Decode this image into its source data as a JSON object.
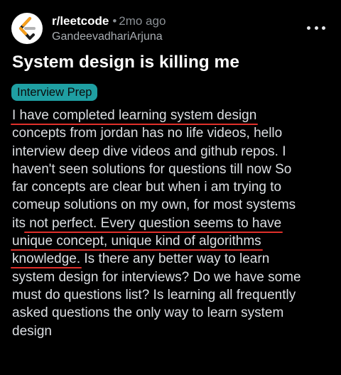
{
  "post": {
    "subreddit": "r/leetcode",
    "separator": "•",
    "time": "2mo ago",
    "author": "GandeevadhariArjuna",
    "title": "System design is killing me",
    "flair": "Interview Prep",
    "body_lines": [
      [
        "I have completed learning system design",
        ""
      ],
      [
        "concepts from jordan has no life videos, hello",
        ""
      ],
      [
        "interview deep dive videos and github repos. I",
        ""
      ],
      [
        "haven't seen solutions for questions till now So",
        ""
      ],
      [
        "far concepts are clear but when i am trying to",
        ""
      ],
      [
        "comeup solutions on my own, for most systems",
        ""
      ],
      [
        "its",
        " not perfect. Every question seems to have"
      ],
      [
        "unique concept, unique kind of algorithms",
        ""
      ],
      [
        "knowledge.",
        " Is there any better way to learn"
      ],
      [
        "system design for interviews? Do we have some",
        ""
      ],
      [
        "must do questions list? Is learning all frequently",
        ""
      ],
      [
        "asked questions the only way to learn system",
        ""
      ],
      [
        "design",
        ""
      ]
    ]
  },
  "icons": {
    "avatar": "leetcode-logo",
    "more": "more-horizontal-icon"
  },
  "colors": {
    "background": "#000000",
    "flair_bg": "#1f9fa2",
    "underline": "#e0302b",
    "logo_orange": "#f89f1b"
  }
}
